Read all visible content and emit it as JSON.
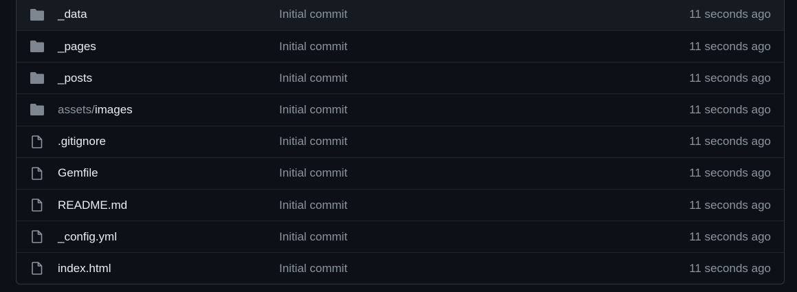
{
  "colors": {
    "background": "#0d1117",
    "row_border": "#21262d",
    "text_primary": "#e6edf3",
    "text_muted": "#8b949e",
    "folder_icon": "#7d8590",
    "file_icon": "#8b949e"
  },
  "files": [
    {
      "type": "folder",
      "icon": "folder-icon",
      "prefix": "",
      "name": "_data",
      "commit": "Initial commit",
      "age": "11 seconds ago"
    },
    {
      "type": "folder",
      "icon": "folder-icon",
      "prefix": "",
      "name": "_pages",
      "commit": "Initial commit",
      "age": "11 seconds ago"
    },
    {
      "type": "folder",
      "icon": "folder-icon",
      "prefix": "",
      "name": "_posts",
      "commit": "Initial commit",
      "age": "11 seconds ago"
    },
    {
      "type": "folder",
      "icon": "folder-icon",
      "prefix": "assets/",
      "name": "images",
      "commit": "Initial commit",
      "age": "11 seconds ago"
    },
    {
      "type": "file",
      "icon": "file-icon",
      "prefix": "",
      "name": ".gitignore",
      "commit": "Initial commit",
      "age": "11 seconds ago"
    },
    {
      "type": "file",
      "icon": "file-icon",
      "prefix": "",
      "name": "Gemfile",
      "commit": "Initial commit",
      "age": "11 seconds ago"
    },
    {
      "type": "file",
      "icon": "file-icon",
      "prefix": "",
      "name": "README.md",
      "commit": "Initial commit",
      "age": "11 seconds ago"
    },
    {
      "type": "file",
      "icon": "file-icon",
      "prefix": "",
      "name": "_config.yml",
      "commit": "Initial commit",
      "age": "11 seconds ago"
    },
    {
      "type": "file",
      "icon": "file-icon",
      "prefix": "",
      "name": "index.html",
      "commit": "Initial commit",
      "age": "11 seconds ago"
    }
  ]
}
